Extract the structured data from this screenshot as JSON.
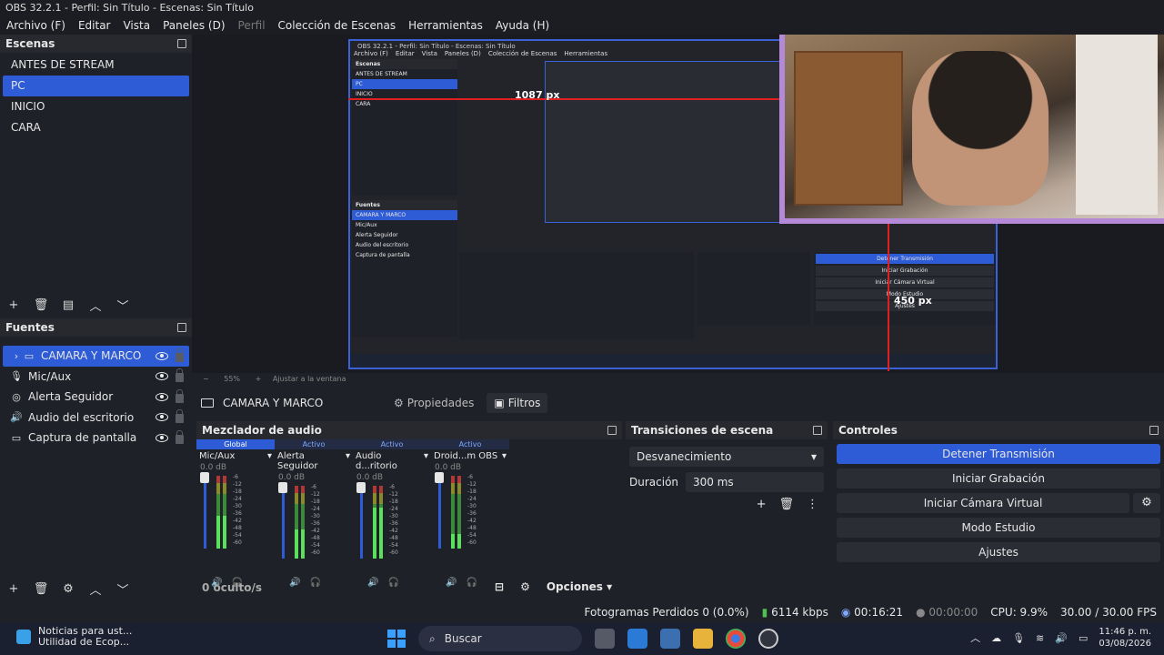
{
  "window": {
    "title": "OBS 32.2.1 - Perfil: Sin Título - Escenas: Sin Título"
  },
  "menu": [
    "Archivo (F)",
    "Editar",
    "Vista",
    "Paneles (D)",
    "Perfil",
    "Colección de Escenas",
    "Herramientas",
    "Ayuda (H)"
  ],
  "scenes": {
    "title": "Escenas",
    "items": [
      "ANTES DE STREAM",
      "PC",
      "INICIO",
      "CARA"
    ],
    "selected": 1
  },
  "sources": {
    "title": "Fuentes",
    "items": [
      {
        "name": "CAMARA Y MARCO",
        "icon": "folder-icon"
      },
      {
        "name": "Mic/Aux",
        "icon": "mic-icon"
      },
      {
        "name": "Alerta Seguidor",
        "icon": "globe-icon"
      },
      {
        "name": "Audio del escritorio",
        "icon": "speaker-icon"
      },
      {
        "name": "Captura de pantalla",
        "icon": "monitor-icon"
      }
    ]
  },
  "preview": {
    "measure_h": "1087 px",
    "measure_v": "450 px",
    "zoom": "55%",
    "fit": "Ajustar a la ventana"
  },
  "context": {
    "source_name": "CAMARA Y MARCO",
    "properties": "Propiedades",
    "filters": "Filtros"
  },
  "mixer": {
    "title": "Mezclador de audio",
    "channels": [
      {
        "status": "Global",
        "name": "Mic/Aux",
        "db": "0.0 dB",
        "level": 0.45
      },
      {
        "status": "Activo",
        "name": "Alerta Seguidor",
        "db": "0.0 dB",
        "level": 0.4
      },
      {
        "status": "Activo",
        "name": "Audio d...ritorio",
        "db": "0.0 dB",
        "level": 0.7
      },
      {
        "status": "Activo",
        "name": "Droid...m OBS",
        "db": "0.0 dB",
        "level": 0.2
      }
    ],
    "scale": [
      "-6",
      "-12",
      "-18",
      "-24",
      "-30",
      "-36",
      "-42",
      "-48",
      "-54",
      "-60"
    ],
    "hidden": "0 oculto/s",
    "options": "Opciones"
  },
  "transitions": {
    "title": "Transiciones de escena",
    "selected": "Desvanecimiento",
    "duration_label": "Duración",
    "duration_value": "300 ms"
  },
  "controls": {
    "title": "Controles",
    "stop_stream": "Detener Transmisión",
    "start_record": "Iniciar Grabación",
    "start_virtual": "Iniciar Cámara Virtual",
    "studio": "Modo Estudio",
    "settings": "Ajustes"
  },
  "status": {
    "dropped": "Fotogramas Perdidos 0 (0.0%)",
    "bitrate": "6114 kbps",
    "stream_time": "00:16:21",
    "record_time": "00:00:00",
    "cpu": "CPU: 9.9%",
    "fps": "30.00 / 30.00 FPS"
  },
  "taskbar": {
    "news_title": "Noticias para ust...",
    "news_sub": "Utilidad de Ecop...",
    "search": "Buscar",
    "time": "11:46 p. m.",
    "date": "03/08/2026"
  },
  "colors": {
    "accent": "#2e5bd6",
    "panel": "#1f2128"
  }
}
